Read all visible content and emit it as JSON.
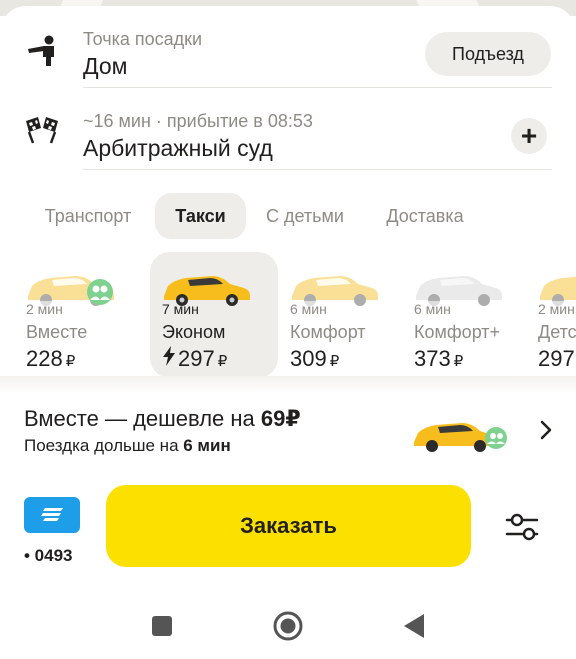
{
  "pickup": {
    "label": "Точка посадки",
    "value": "Дом",
    "entrance_button": "Подъезд",
    "icon": "person-pointing-icon"
  },
  "destination": {
    "eta_text": "~16 мин · прибытие в 08:53",
    "value": "Арбитражный суд",
    "add_stop_button": "+",
    "icon": "checkered-flags-icon"
  },
  "tabs": [
    {
      "label": "Транспорт",
      "active": false
    },
    {
      "label": "Такси",
      "active": true
    },
    {
      "label": "С детьми",
      "active": false
    },
    {
      "label": "Доставка",
      "active": false
    }
  ],
  "tariffs": [
    {
      "eta": "2 мин",
      "name": "Вместе",
      "price": "228",
      "currency": "₽",
      "car_color": "#f7c843",
      "active": false
    },
    {
      "eta": "7 мин",
      "name": "Эконом",
      "price": "297",
      "currency": "₽",
      "car_color": "#f6bd1c",
      "active": true
    },
    {
      "eta": "6 мин",
      "name": "Комфорт",
      "price": "309",
      "currency": "₽",
      "car_color": "#f7c843",
      "active": false
    },
    {
      "eta": "6 мин",
      "name": "Комфорт+",
      "price": "373",
      "currency": "₽",
      "car_color": "#e6e6e6",
      "active": false
    },
    {
      "eta": "2 мин",
      "name": "Детс",
      "price": "297",
      "currency": "",
      "car_color": "#f7c843",
      "active": false
    }
  ],
  "promo": {
    "title_prefix": "Вместе — дешевле на ",
    "title_amount": "69₽",
    "text_prefix": "Поездка дольше на ",
    "text_amount": "6 мин"
  },
  "payment": {
    "last_digits": "• 0493",
    "card_color": "#1e9ee8"
  },
  "order_button": "Заказать",
  "colors": {
    "accent_yellow": "#fce000",
    "tab_active_bg": "#efedea",
    "muted_text": "#8e8b86"
  }
}
